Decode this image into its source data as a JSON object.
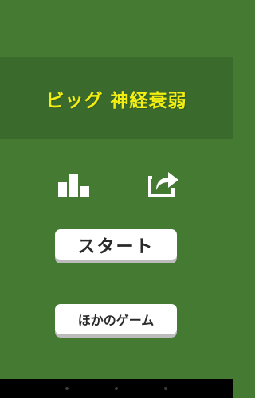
{
  "title": "ビッグ 神経衰弱",
  "icons": {
    "stats": "bar-chart-icon",
    "share": "share-icon"
  },
  "buttons": {
    "start_label": "スタート",
    "other_games_label": "ほかのゲーム"
  },
  "colors": {
    "background": "#457a33",
    "title_band": "#3a6a2c",
    "title_text": "#f2ee12",
    "button_bg": "#ffffff",
    "button_text": "#2a2a2a",
    "icon": "#ffffff"
  },
  "nav_bar": {
    "items": [
      "back",
      "home",
      "recent-apps"
    ]
  }
}
